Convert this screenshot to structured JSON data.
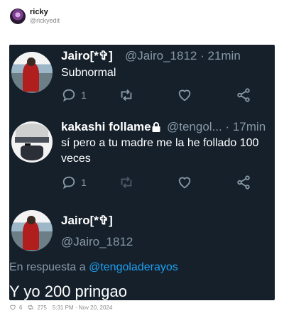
{
  "post": {
    "author_name": "ricky",
    "author_handle": "@rickyedit",
    "likes": "6",
    "reposts": "275",
    "timestamp": "5:31 PM · Nov 20, 2024"
  },
  "screenshot": {
    "tweets": [
      {
        "name": "Jairo[*✞]",
        "meta": "@Jairo_1812 · 21min",
        "text": "Subnormal",
        "reply_count": "1",
        "avatar_icon": "jairo-avatar"
      },
      {
        "name": "kakashi follame",
        "meta": "@tengol... · 17min",
        "text_line1": "sí pero a tu madre me la he follado 100",
        "text_line2": "veces",
        "reply_count": "1",
        "protected_icon": "lock-icon",
        "avatar_icon": "kakashi-avatar"
      }
    ],
    "reply": {
      "name": "Jairo[*✞]",
      "handle": "@Jairo_1812",
      "replying_prefix": "En respuesta a ",
      "replying_to": "@tengoladerayos",
      "text": "Y yo 200 pringao"
    }
  },
  "colors": {
    "background": "#15202b",
    "text": "#ffffff",
    "muted": "#8899a6",
    "link": "#1da1f2"
  }
}
